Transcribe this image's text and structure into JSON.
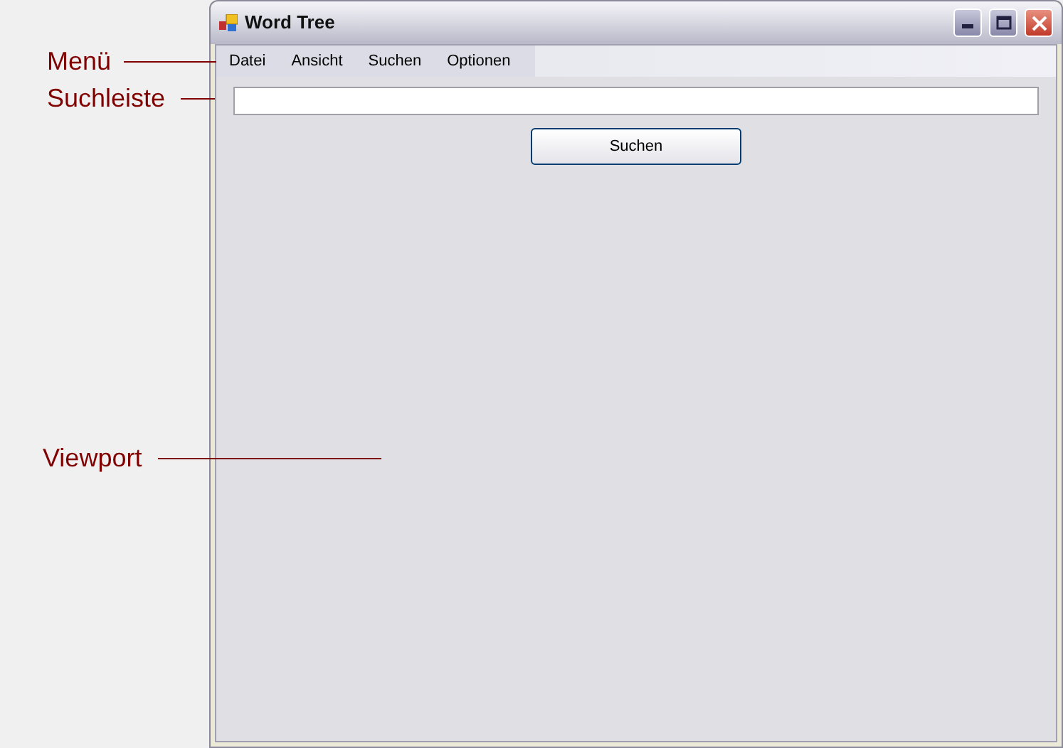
{
  "window": {
    "title": "Word Tree"
  },
  "menu": [
    {
      "label": "Datei"
    },
    {
      "label": "Ansicht"
    },
    {
      "label": "Suchen"
    },
    {
      "label": "Optionen"
    }
  ],
  "search": {
    "button": "Suchen"
  },
  "annotations": [
    {
      "label": "Menü"
    },
    {
      "label": "Suchleiste"
    },
    {
      "label": "Viewport"
    }
  ]
}
